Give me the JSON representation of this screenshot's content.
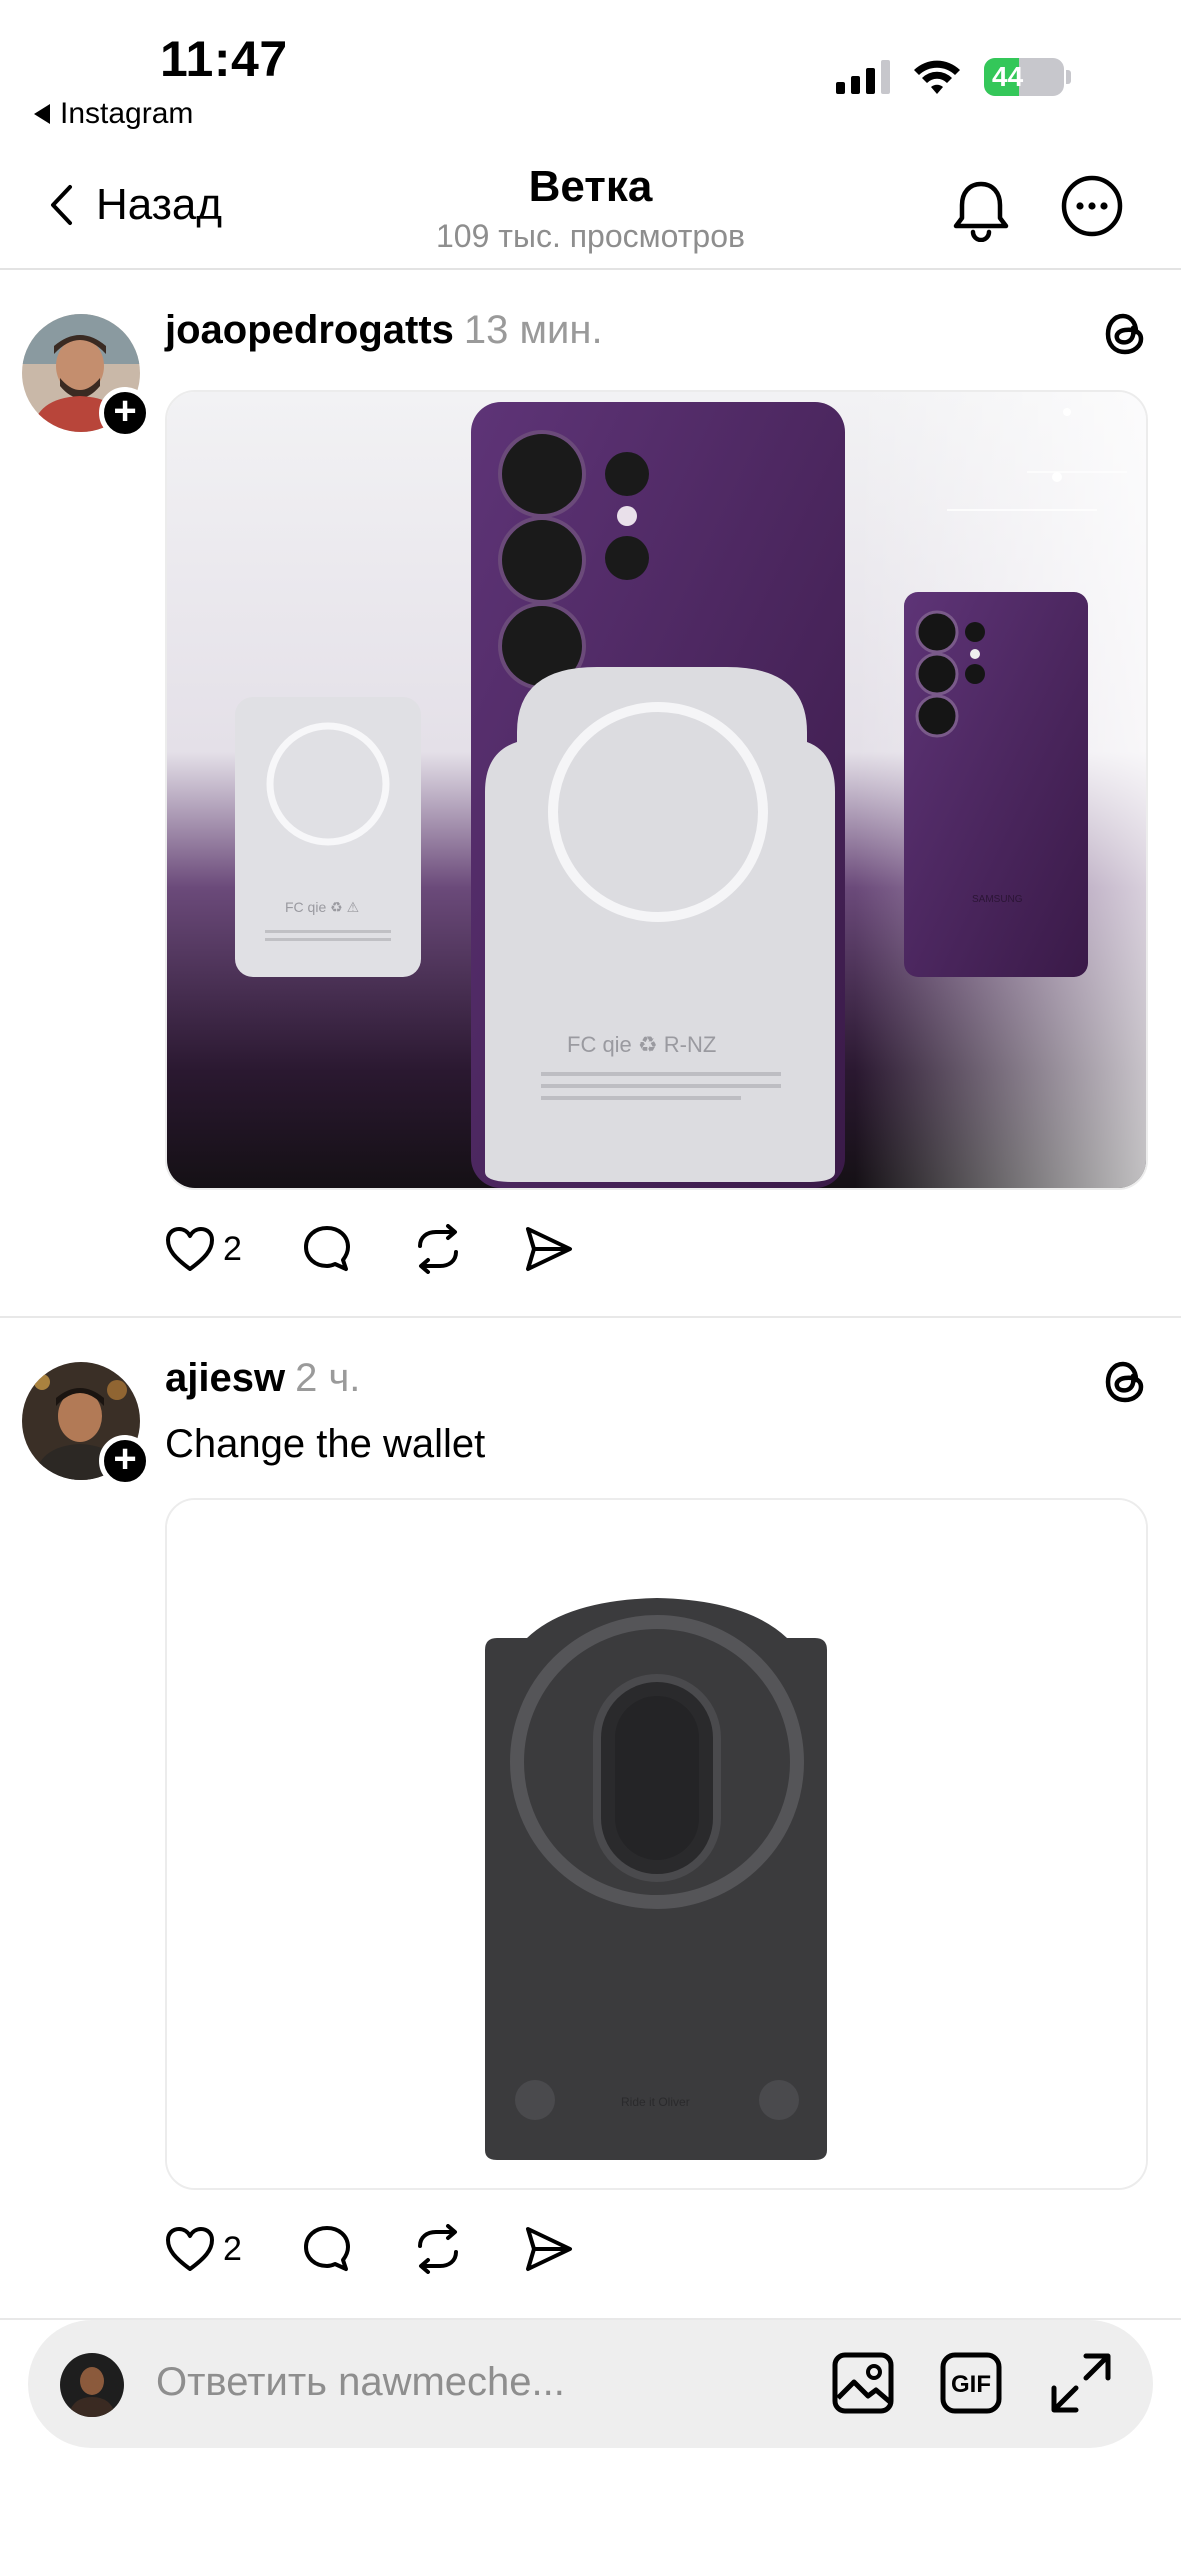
{
  "status_bar": {
    "time": "11:47",
    "back_app": "Instagram",
    "battery": "44"
  },
  "nav": {
    "back_label": "Назад",
    "title": "Ветка",
    "subtitle": "109 тыс. просмотров"
  },
  "posts": [
    {
      "username": "joaopedrogatts",
      "time": "13 мин.",
      "caption": "",
      "likes": "2"
    },
    {
      "username": "ajiesw",
      "time": "2 ч.",
      "caption": "Change the wallet",
      "likes": "2"
    }
  ],
  "reply": {
    "placeholder": "Ответить nawmeche..."
  },
  "colors": {
    "accent_green": "#34c759",
    "muted_text": "#8e8e8e",
    "purple_phone": "#4a2360"
  }
}
